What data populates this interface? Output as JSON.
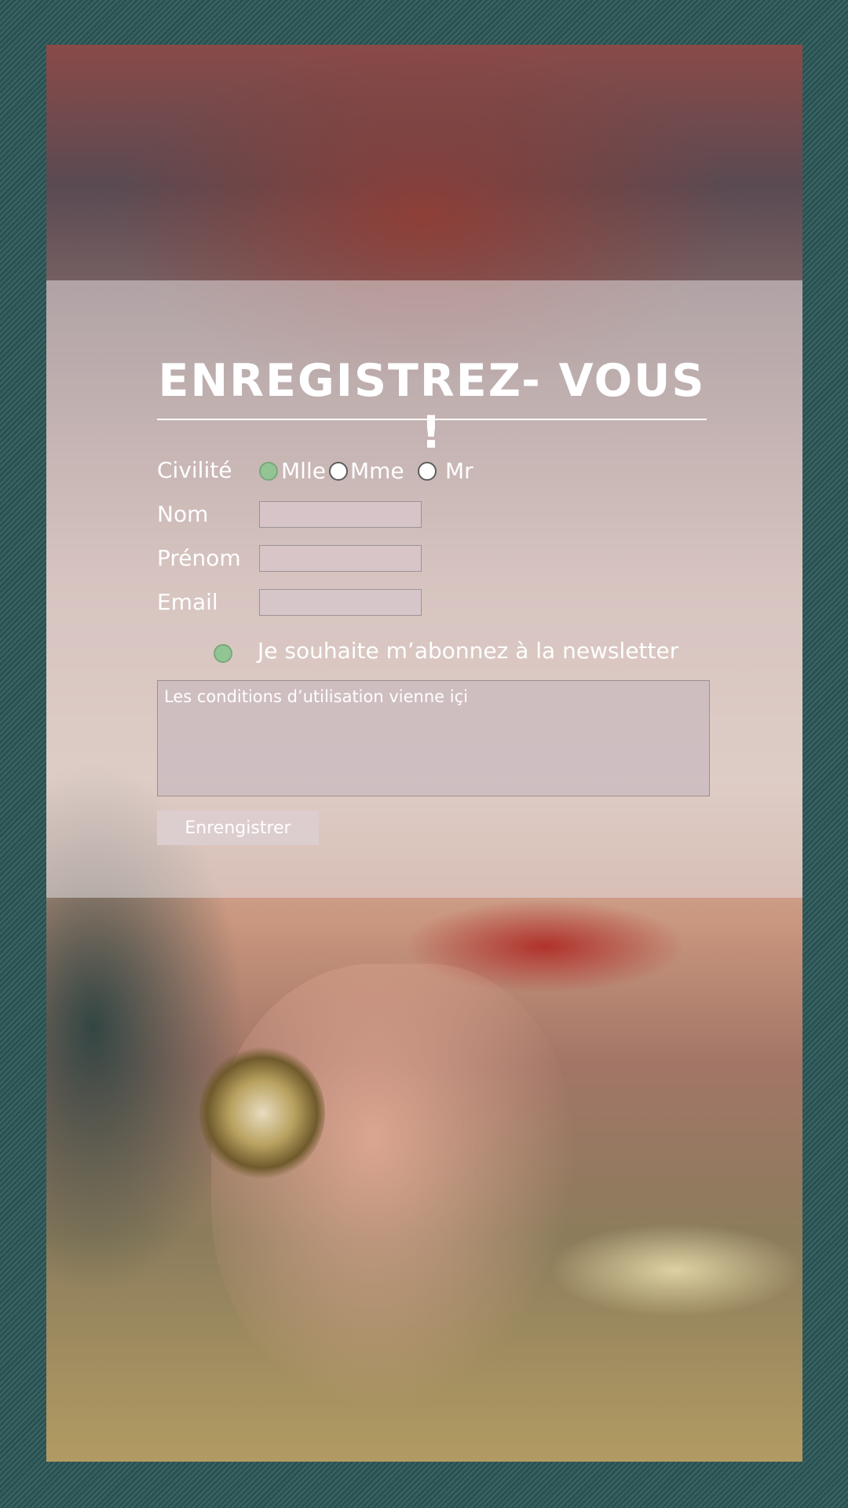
{
  "form": {
    "title": "ENREGISTREZ- VOUS !",
    "civility": {
      "label": "Civilité",
      "options": [
        "Mlle",
        "Mme",
        "Mr"
      ],
      "selected": "Mlle"
    },
    "nom_label": "Nom",
    "prenom_label": "Prénom",
    "email_label": "Email",
    "newsletter": {
      "label": "Je souhaite m’abonnez à la newsletter",
      "checked": true
    },
    "terms_text": "Les conditions d’utilisation vienne içi",
    "submit_label": "Enrengistrer"
  },
  "colors": {
    "page_background": "#2f5a5a",
    "selected_radio": "#93c494",
    "text": "#ffffff"
  }
}
